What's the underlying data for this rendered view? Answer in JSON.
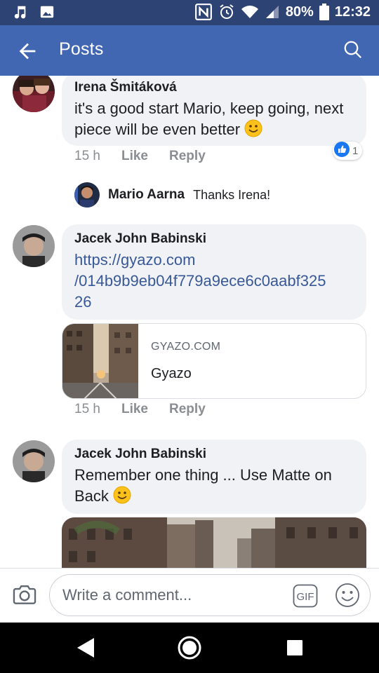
{
  "status_bar": {
    "battery": "80%",
    "time": "12:32"
  },
  "app_bar": {
    "title": "Posts"
  },
  "comments": [
    {
      "author": "Irena Šmitáková",
      "text": "it's a good start Mario, keep going, next piece will be even better",
      "emoji": "slight-smile-emoji",
      "time": "15 h",
      "like": "Like",
      "reply": "Reply",
      "reaction_count": "1",
      "replies": [
        {
          "author": "Mario Aarna",
          "text": "Thanks Irena!"
        }
      ]
    },
    {
      "author": "Jacek John Babinski",
      "link": "https://gyazo.com/014b9b9eb04f779a9ece6c0aabf32526",
      "link_line1": "https://gyazo.com",
      "link_line2": "/014b9b9eb04f779a9ece6c0aabf325",
      "link_line3": "26",
      "preview": {
        "domain": "GYAZO.COM",
        "title": "Gyazo"
      },
      "time": "15 h",
      "like": "Like",
      "reply": "Reply"
    },
    {
      "author": "Jacek John Babinski",
      "text": "Remember one thing ... Use Matte on Back",
      "emoji": "slight-smile-emoji"
    }
  ],
  "composer": {
    "placeholder": "Write a comment...",
    "gif_label": "GIF"
  },
  "colors": {
    "status_bar": "#2d4373",
    "app_bar": "#4267b2",
    "bubble": "#f0f2f5",
    "link": "#385898",
    "meta": "#8a8d91"
  }
}
